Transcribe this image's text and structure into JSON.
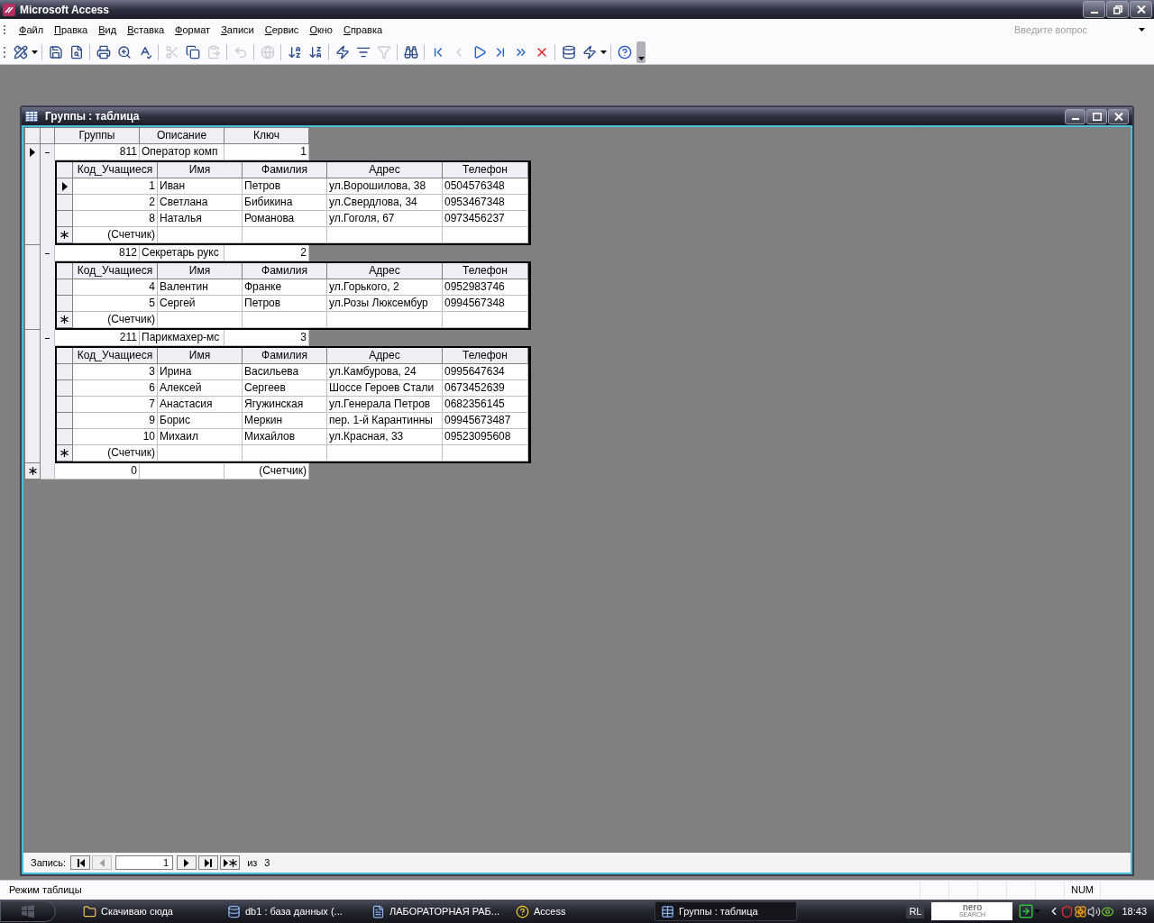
{
  "app": {
    "title": "Microsoft Access"
  },
  "menu": [
    "Файл",
    "Правка",
    "Вид",
    "Вставка",
    "Формат",
    "Записи",
    "Сервис",
    "Окно",
    "Справка"
  ],
  "help_box": {
    "placeholder": "Введите вопрос"
  },
  "toolbar": [
    {
      "kind": "view",
      "disabled": false
    },
    {
      "kind": "dropdown"
    },
    {
      "kind": "separator"
    },
    {
      "kind": "save",
      "disabled": false
    },
    {
      "kind": "file_search",
      "disabled": false
    },
    {
      "kind": "separator"
    },
    {
      "kind": "print",
      "disabled": false
    },
    {
      "kind": "preview",
      "disabled": false
    },
    {
      "kind": "spelling",
      "disabled": false
    },
    {
      "kind": "separator"
    },
    {
      "kind": "cut",
      "disabled": true
    },
    {
      "kind": "copy",
      "disabled": false
    },
    {
      "kind": "paste",
      "disabled": true
    },
    {
      "kind": "separator"
    },
    {
      "kind": "undo",
      "disabled": true
    },
    {
      "kind": "separator"
    },
    {
      "kind": "hyperlink",
      "disabled": true
    },
    {
      "kind": "separator"
    },
    {
      "kind": "sort_asc",
      "disabled": false
    },
    {
      "kind": "sort_desc",
      "disabled": false
    },
    {
      "kind": "separator"
    },
    {
      "kind": "filter_selection",
      "disabled": false
    },
    {
      "kind": "filter_form",
      "disabled": false
    },
    {
      "kind": "filter_apply",
      "disabled": true
    },
    {
      "kind": "separator"
    },
    {
      "kind": "find",
      "disabled": false
    },
    {
      "kind": "separator"
    },
    {
      "kind": "first",
      "disabled": false
    },
    {
      "kind": "prev",
      "disabled": true
    },
    {
      "kind": "next",
      "disabled": false
    },
    {
      "kind": "last",
      "disabled": false
    },
    {
      "kind": "new_record",
      "disabled": false
    },
    {
      "kind": "delete_record",
      "disabled": false
    },
    {
      "kind": "separator"
    },
    {
      "kind": "database_window",
      "disabled": false
    },
    {
      "kind": "new_object",
      "disabled": false
    },
    {
      "kind": "dropdown"
    },
    {
      "kind": "separator"
    },
    {
      "kind": "help",
      "disabled": false
    }
  ],
  "child_window": {
    "title": "Группы : таблица"
  },
  "datasheet": {
    "columns": [
      "Группы",
      "Описание",
      "Ключ"
    ],
    "groups": [
      {
        "cells": [
          "811",
          "Оператор комп",
          "1"
        ],
        "current": true,
        "expanded": true,
        "subtable": {
          "columns": [
            "Код_Учащиеся",
            "Имя",
            "Фамилия",
            "Адрес",
            "Телефон"
          ],
          "rows": [
            {
              "cells": [
                "1",
                "Иван",
                "Петров",
                "ул.Ворошилова, 38",
                "0504576348"
              ],
              "current": true
            },
            {
              "cells": [
                "2",
                "Светлана",
                "Бибикина",
                "ул.Свердлова, 34",
                "0953467348"
              ],
              "current": false
            },
            {
              "cells": [
                "8",
                "Наталья",
                "Романова",
                "ул.Гоголя, 67",
                "0973456237"
              ],
              "current": false
            }
          ],
          "new_row": "(Счетчик)"
        }
      },
      {
        "cells": [
          "812",
          "Секретарь рукс",
          "2"
        ],
        "current": false,
        "expanded": true,
        "subtable": {
          "columns": [
            "Код_Учащиеся",
            "Имя",
            "Фамилия",
            "Адрес",
            "Телефон"
          ],
          "rows": [
            {
              "cells": [
                "4",
                "Валентин",
                "Франке",
                "ул.Горького, 2",
                "0952983746"
              ],
              "current": false
            },
            {
              "cells": [
                "5",
                "Сергей",
                "Петров",
                "ул.Розы Люксембур",
                "0994567348"
              ],
              "current": false
            }
          ],
          "new_row": "(Счетчик)"
        }
      },
      {
        "cells": [
          "211",
          "Парикмахер-мс",
          "3"
        ],
        "current": false,
        "expanded": true,
        "subtable": {
          "columns": [
            "Код_Учащиеся",
            "Имя",
            "Фамилия",
            "Адрес",
            "Телефон"
          ],
          "rows": [
            {
              "cells": [
                "3",
                "Ирина",
                "Васильева",
                "ул.Камбурова, 24",
                "0995647634"
              ],
              "current": false
            },
            {
              "cells": [
                "6",
                "Алексей",
                "Сергеев",
                "Шоссе Героев Стали",
                "0673452639"
              ],
              "current": false
            },
            {
              "cells": [
                "7",
                "Анастасия",
                "Ягужинская",
                "ул.Генерала Петров",
                "0682356145"
              ],
              "current": false
            },
            {
              "cells": [
                "9",
                "Борис",
                "Меркин",
                "пер. 1-й Карантинны",
                "09945673487"
              ],
              "current": false
            },
            {
              "cells": [
                "10",
                "Михаил",
                "Михайлов",
                "ул.Красная, 33",
                "09523095608"
              ],
              "current": false
            }
          ],
          "new_row": "(Счетчик)"
        }
      }
    ],
    "new_row": {
      "group": "0",
      "key": "(Счетчик)"
    }
  },
  "navigation": {
    "label": "Запись:",
    "current": "1",
    "of_label": "из",
    "total": "3"
  },
  "status_bar": {
    "mode": "Режим таблицы",
    "num": "NUM"
  },
  "taskbar": {
    "items": [
      {
        "kind": "folder",
        "label": "Скачиваю сюда",
        "selected": false
      },
      {
        "kind": "database",
        "label": "db1 : база данных (...",
        "selected": false
      },
      {
        "kind": "word",
        "label": "ЛАБОРАТОРНАЯ РАБ...",
        "selected": false
      },
      {
        "kind": "help",
        "label": "Access",
        "selected": false
      },
      {
        "kind": "table",
        "label": "Группы : таблица",
        "selected": true
      }
    ],
    "lang": "RL",
    "search_logo": [
      "nero",
      "SEARCH"
    ],
    "clock": "18:43"
  }
}
